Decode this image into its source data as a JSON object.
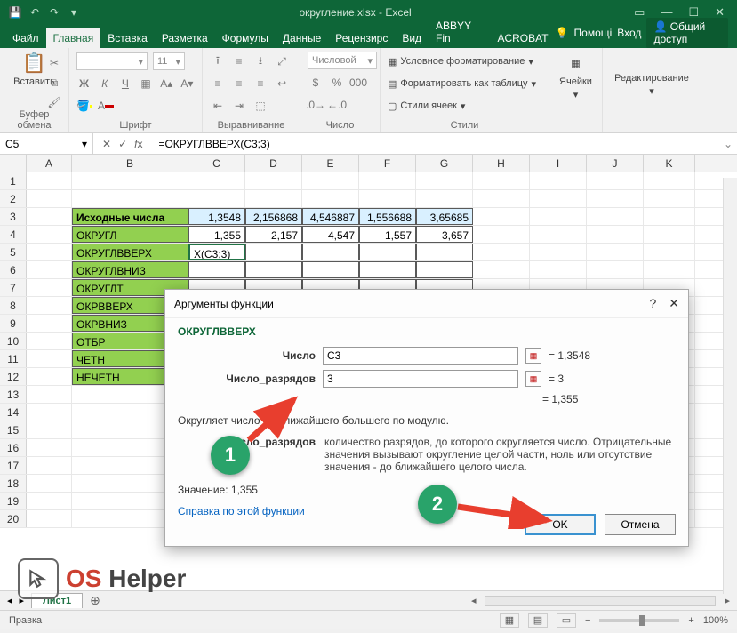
{
  "app": {
    "title": "округление.xlsx - Excel",
    "share": "Общий доступ",
    "help": "Помощі",
    "signin": "Вход"
  },
  "tabs": {
    "file": "Файл",
    "home": "Главная",
    "insert": "Вставка",
    "layout": "Разметка",
    "formulas": "Формулы",
    "data": "Данные",
    "review": "Рецензирс",
    "view": "Вид",
    "abbyy": "ABBYY Fin",
    "acrobat": "ACROBAT"
  },
  "ribbon": {
    "paste": "Вставить",
    "clipboard": "Буфер обмена",
    "font_group": "Шрифт",
    "font_size": "11",
    "align_group": "Выравнивание",
    "number_group": "Число",
    "number_fmt": "Числовой",
    "styles_group": "Стили",
    "cond_fmt": "Условное форматирование",
    "fmt_table": "Форматировать как таблицу",
    "cell_styles": "Стили ячеек",
    "cells_group": "Ячейки",
    "editing_group": "Редактирование"
  },
  "fbar": {
    "namebox": "C5",
    "formula": "=ОКРУГЛВВЕРХ(C3;3)"
  },
  "columns": [
    "A",
    "B",
    "C",
    "D",
    "E",
    "F",
    "G",
    "H",
    "I",
    "J",
    "K"
  ],
  "rows": [
    "1",
    "2",
    "3",
    "4",
    "5",
    "6",
    "7",
    "8",
    "9",
    "10",
    "11",
    "12",
    "13",
    "14",
    "15",
    "16",
    "17",
    "18",
    "19",
    "20"
  ],
  "sheet": {
    "hdr_b3": "Исходные числа",
    "c3": "1,3548",
    "d3": "2,156868",
    "e3": "4,546887",
    "f3": "1,556688",
    "g3": "3,65685",
    "b4": "ОКРУГЛ",
    "c4": "1,355",
    "d4": "2,157",
    "e4": "4,547",
    "f4": "1,557",
    "g4": "3,657",
    "b5": "ОКРУГЛВВЕРХ",
    "c5": "X(C3;3)",
    "b6": "ОКРУГЛВНИЗ",
    "b7": "ОКРУГЛТ",
    "b8": "ОКРВВЕРХ",
    "b9": "ОКРВНИЗ",
    "b10": "ОТБР",
    "b11": "ЧЕТН",
    "b12": "НЕЧЕТН"
  },
  "dialog": {
    "title": "Аргументы функции",
    "fn": "ОКРУГЛВВЕРХ",
    "arg1_label": "Число",
    "arg1_val": "C3",
    "arg1_res": "1,3548",
    "arg2_label": "Число_разрядов",
    "arg2_val": "3",
    "arg2_res": "3",
    "result_eq": "1,355",
    "desc": "Округляет число до ближайшего большего по модулю.",
    "argdesc_name": "Число_разрядов",
    "argdesc_text": "количество разрядов, до которого округляется число. Отрицательные значения вызывают округление целой части, ноль или отсутствие значения - до ближайшего целого числа.",
    "value_label": "Значение:",
    "value": "1,355",
    "help_link": "Справка по этой функции",
    "ok": "OK",
    "cancel": "Отмена"
  },
  "sheettab": "Лист1",
  "status": {
    "mode": "Правка",
    "zoom": "100%"
  },
  "watermark": {
    "os": "OS ",
    "helper": "Helper"
  },
  "badges": {
    "one": "1",
    "two": "2"
  }
}
